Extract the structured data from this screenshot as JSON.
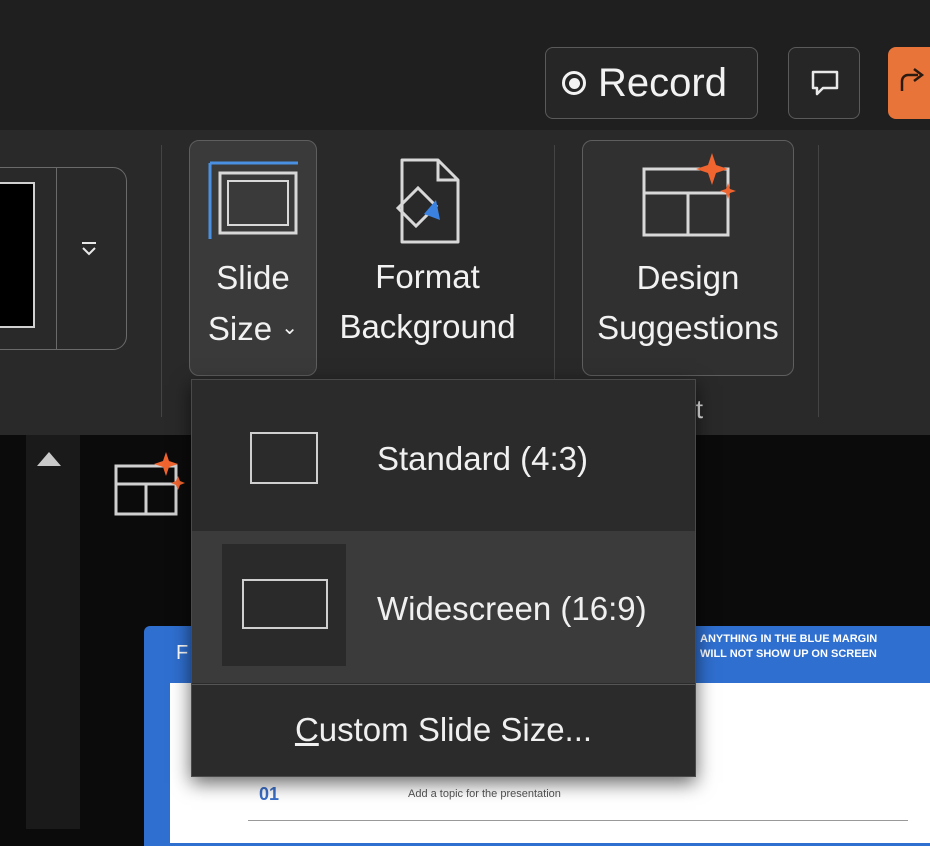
{
  "titlebar": {
    "record_label": "Record",
    "icons": [
      "record-icon",
      "comment-icon",
      "share-icon"
    ]
  },
  "ribbon": {
    "slide_size_label_line1": "Slide",
    "slide_size_label_line2": "Size",
    "slide_size_chevron": "⌄",
    "format_background_line1": "Format",
    "format_background_line2": "Background",
    "design_suggestions_line1": "Design",
    "design_suggestions_line2": "Suggestions",
    "group_label_partial": "it",
    "gallery_more_icon": "more-icon"
  },
  "slide_size_menu": {
    "items": [
      {
        "label": "Standard (4:3)",
        "icon": "standard-aspect-icon",
        "selected": false
      },
      {
        "label": "Widescreen (16:9)",
        "icon": "widescreen-aspect-icon",
        "selected": true
      }
    ],
    "custom_mnemonic": "C",
    "custom_rest": "ustom Slide Size..."
  },
  "slide": {
    "margin_note_line1": "ANYTHING IN THE BLUE MARGIN",
    "margin_note_line2": "WILL NOT SHOW UP ON SCREEN",
    "corner_letter": "F",
    "item_number": "01",
    "item_topic": "Add a topic for the presentation"
  },
  "colors": {
    "accent_orange": "#e8743a",
    "slide_blue": "#2f6fcf",
    "sparkle_orange": "#f0642f"
  }
}
